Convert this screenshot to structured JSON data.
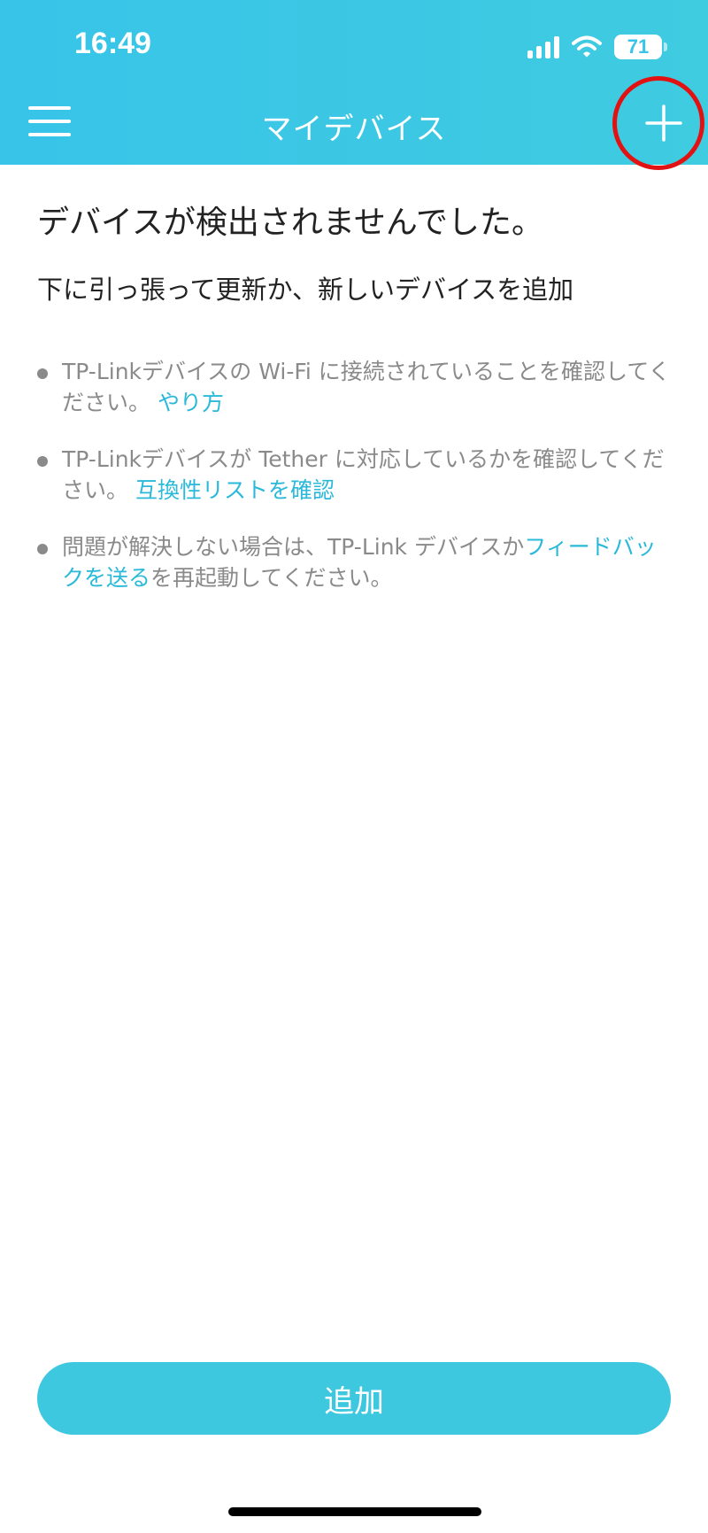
{
  "status_bar": {
    "time": "16:49",
    "battery": "71",
    "icons": [
      "cellular-signal-icon",
      "wifi-icon",
      "battery-icon"
    ]
  },
  "nav": {
    "title": "マイデバイス",
    "menu_icon": "hamburger-menu-icon",
    "add_icon": "plus-icon"
  },
  "main": {
    "heading": "デバイスが検出されませんでした。",
    "subheading": "下に引っ張って更新か、新しいデバイスを追加",
    "tips": [
      {
        "text_before": "TP-Linkデバイスの Wi-Fi に接続されていることを確認してください。",
        "link": "やり方",
        "text_after": ""
      },
      {
        "text_before": "TP-Linkデバイスが Tether に対応しているかを確認してください。",
        "link": "互換性リストを確認",
        "text_after": ""
      },
      {
        "text_before": "問題が解決しない場合は、TP-Link デバイスか",
        "link": "フィードバックを送る",
        "text_after": "を再起動してください。"
      }
    ]
  },
  "footer": {
    "add_button_label": "追加"
  },
  "colors": {
    "header": "#38c4e8",
    "accent": "#2bb9d9",
    "button": "#3ec8e0",
    "highlight": "#e21212"
  }
}
